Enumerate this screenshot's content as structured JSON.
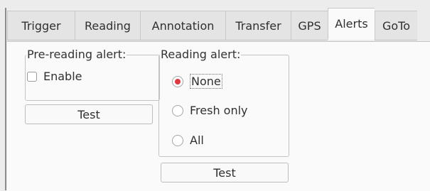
{
  "tabs": [
    {
      "label": "Trigger",
      "active": false
    },
    {
      "label": "Reading",
      "active": false
    },
    {
      "label": "Annotation",
      "active": false
    },
    {
      "label": "Transfer",
      "active": false
    },
    {
      "label": "GPS",
      "active": false
    },
    {
      "label": "Alerts",
      "active": true
    },
    {
      "label": "GoTo",
      "active": false
    }
  ],
  "pre_reading_alert": {
    "legend": "Pre-reading alert:",
    "enable_label": "Enable",
    "enable_checked": false,
    "test_label": "Test"
  },
  "reading_alert": {
    "legend": "Reading alert:",
    "options": [
      {
        "label": "None",
        "checked": true
      },
      {
        "label": "Fresh only",
        "checked": false
      },
      {
        "label": "All",
        "checked": false
      }
    ],
    "test_label": "Test"
  },
  "colors": {
    "radio_selected": "#e0393e"
  }
}
